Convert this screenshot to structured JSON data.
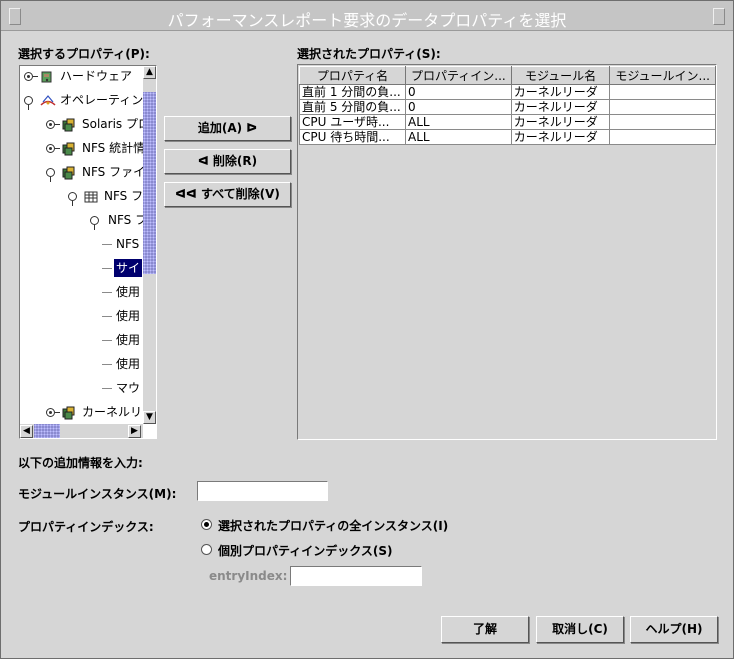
{
  "window": {
    "title": "パフォーマンスレポート要求のデータプロパティを選択"
  },
  "left_panel": {
    "label": "選択するプロパティ(P):"
  },
  "tree": [
    {
      "label": "ハードウェア",
      "icon": "hardware-icon",
      "expanded": false,
      "selected": false
    },
    {
      "label": "オペレーティン",
      "icon": "solaris-icon",
      "expanded": true,
      "selected": false
    },
    {
      "label": "Solaris プロ",
      "icon": "module-icon",
      "expanded": false,
      "selected": false
    },
    {
      "label": "NFS 統計情",
      "icon": "module-icon",
      "expanded": false,
      "selected": false
    },
    {
      "label": "NFS ファイ",
      "icon": "module-icon",
      "expanded": true,
      "selected": false
    },
    {
      "label": "NFS フ",
      "icon": "table-icon",
      "expanded": true,
      "selected": false
    },
    {
      "label": "NFS フ",
      "icon": "none",
      "expanded": true,
      "selected": false
    },
    {
      "label": "NFS",
      "icon": "none",
      "expanded": false,
      "selected": false
    },
    {
      "label": "サイ",
      "icon": "none",
      "expanded": false,
      "selected": true
    },
    {
      "label": "使用",
      "icon": "none",
      "expanded": false,
      "selected": false
    },
    {
      "label": "使用",
      "icon": "none",
      "expanded": false,
      "selected": false
    },
    {
      "label": "使用",
      "icon": "none",
      "expanded": false,
      "selected": false
    },
    {
      "label": "使用",
      "icon": "none",
      "expanded": false,
      "selected": false
    },
    {
      "label": "マウ",
      "icon": "none",
      "expanded": false,
      "selected": false
    },
    {
      "label": "カーネルリ",
      "icon": "module-icon",
      "expanded": false,
      "selected": false
    }
  ],
  "buttons": {
    "add": "追加(A) ᐅ",
    "remove": "ᐊ 削除(R)",
    "remove_all": "ᐊᐊ すべて削除(V)",
    "ok": "了解",
    "cancel": "取消し(C)",
    "help": "ヘルプ(H)"
  },
  "right_panel": {
    "label": "選択されたプロパティ(S):"
  },
  "selected_table": {
    "columns": [
      "プロパティ名",
      "プロパティイン...",
      "モジュール名",
      "モジュールイン..."
    ],
    "rows": [
      [
        "直前 1 分間の負...",
        "0",
        "カーネルリーダ",
        ""
      ],
      [
        "直前 5 分間の負...",
        "0",
        "カーネルリーダ",
        ""
      ],
      [
        "CPU ユーザ時...",
        "ALL",
        "カーネルリーダ",
        ""
      ],
      [
        "CPU 待ち時間...",
        "ALL",
        "カーネルリーダ",
        ""
      ]
    ]
  },
  "extra": {
    "heading": "以下の追加情報を入力:",
    "module_instance_label": "モジュールインスタンス(M):",
    "module_instance_value": "",
    "property_index_label": "プロパティインデックス:",
    "radio_all": "選択されたプロパティの全インスタンス(I)",
    "radio_individual": "個別プロパティインデックス(S)",
    "radio_selected": "all",
    "entry_index_label": "entryIndex:",
    "entry_index_value": ""
  },
  "colors": {
    "selection": "#00006e",
    "window_bg": "#d6d6d6",
    "scroll_thumb": "#8a8ad0"
  }
}
